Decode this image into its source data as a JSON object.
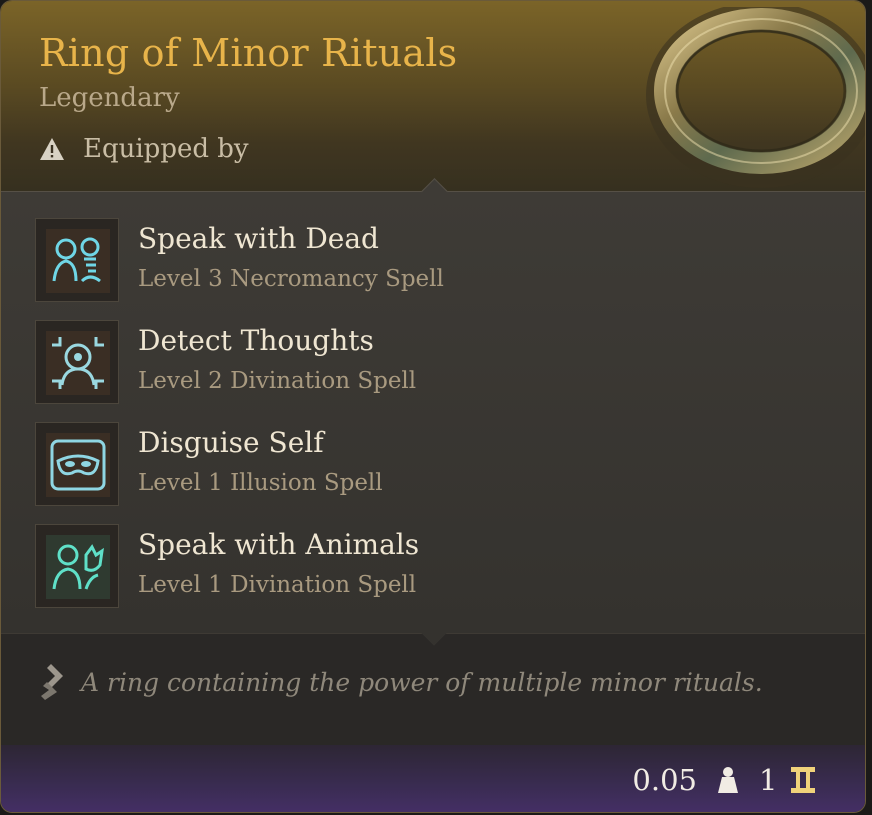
{
  "item": {
    "name": "Ring of Minor Rituals",
    "rarity": "Legendary",
    "equipped_label": "Equipped by"
  },
  "spells": [
    {
      "name": "Speak with Dead",
      "level": "Level 3 Necromancy Spell",
      "icon": "speak-with-dead-icon"
    },
    {
      "name": "Detect Thoughts",
      "level": "Level 2 Divination Spell",
      "icon": "detect-thoughts-icon"
    },
    {
      "name": "Disguise Self",
      "level": "Level 1 Illusion Spell",
      "icon": "disguise-self-icon"
    },
    {
      "name": "Speak with Animals",
      "level": "Level 1 Divination Spell",
      "icon": "speak-with-animals-icon"
    }
  ],
  "description": "A ring containing the power of multiple minor rituals.",
  "footer": {
    "weight": "0.05",
    "value": "1"
  },
  "colors": {
    "item_name": "#e8b44a",
    "rarity": "#b9a88a",
    "spell_name": "#efe6d2",
    "spell_level": "#a99a80",
    "rune_glow": "#6fd6e6",
    "footer_purple": "#452f66"
  }
}
